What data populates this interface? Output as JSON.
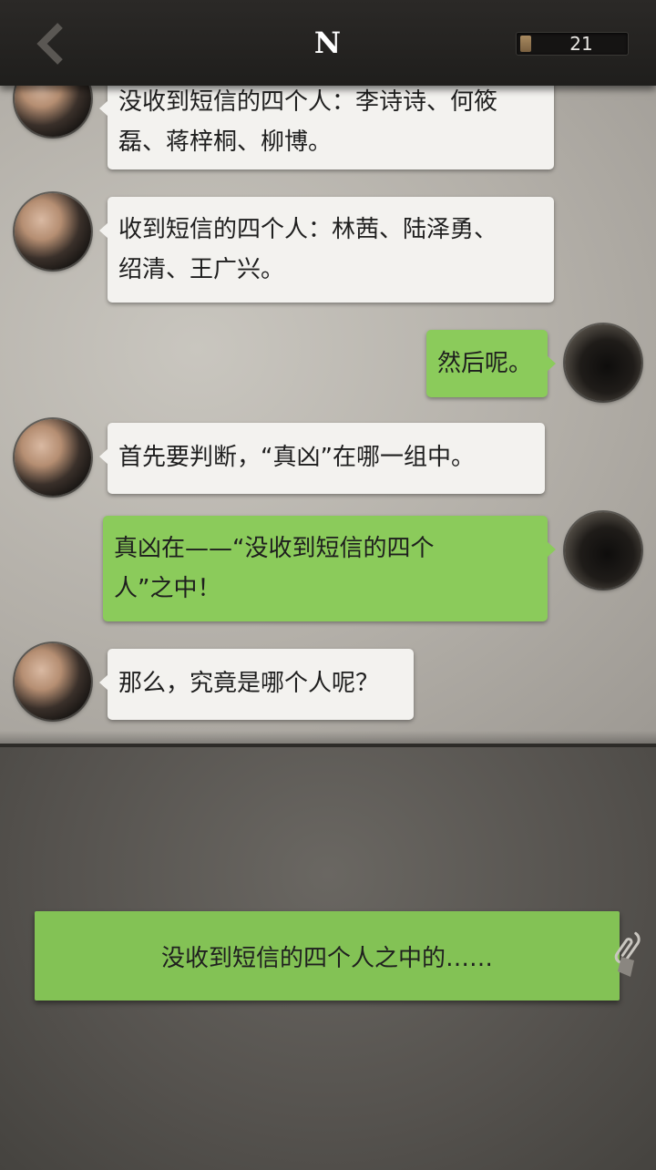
{
  "header": {
    "title": "N",
    "counter": "21",
    "back_icon": "chevron-left-icon"
  },
  "messages": [
    {
      "side": "left",
      "text": "没收到短信的四个人：李诗诗、何筱磊、蒋梓桐、柳博。",
      "lines": [
        "没收到短信的四个人：李诗诗、何筱",
        "磊、蒋梓桐、柳博。"
      ]
    },
    {
      "side": "left",
      "text": "收到短信的四个人：林茜、陆泽勇、绍清、王广兴。",
      "lines": [
        "收到短信的四个人：林茜、陆泽勇、",
        "绍清、王广兴。"
      ]
    },
    {
      "side": "right",
      "text": "然后呢。",
      "lines": [
        "然后呢。"
      ]
    },
    {
      "side": "left",
      "text": "首先要判断，“真凶”在哪一组中。",
      "lines": [
        "首先要判断，“真凶”在哪一组中。"
      ]
    },
    {
      "side": "right",
      "text": "真凶在——“没收到短信的四个人”之中！",
      "lines": [
        "真凶在——“没收到短信的四个",
        "人”之中！"
      ]
    },
    {
      "side": "left",
      "text": "那么，究竟是哪个人呢？",
      "lines": [
        "那么，究竟是哪个人呢？"
      ]
    }
  ],
  "reply_option": {
    "text": "没收到短信的四个人之中的……",
    "icon": "paperclip-icon"
  },
  "colors": {
    "bubble_left": "#f3f2ef",
    "bubble_right": "#8bcb5b",
    "option": "#83c255"
  }
}
